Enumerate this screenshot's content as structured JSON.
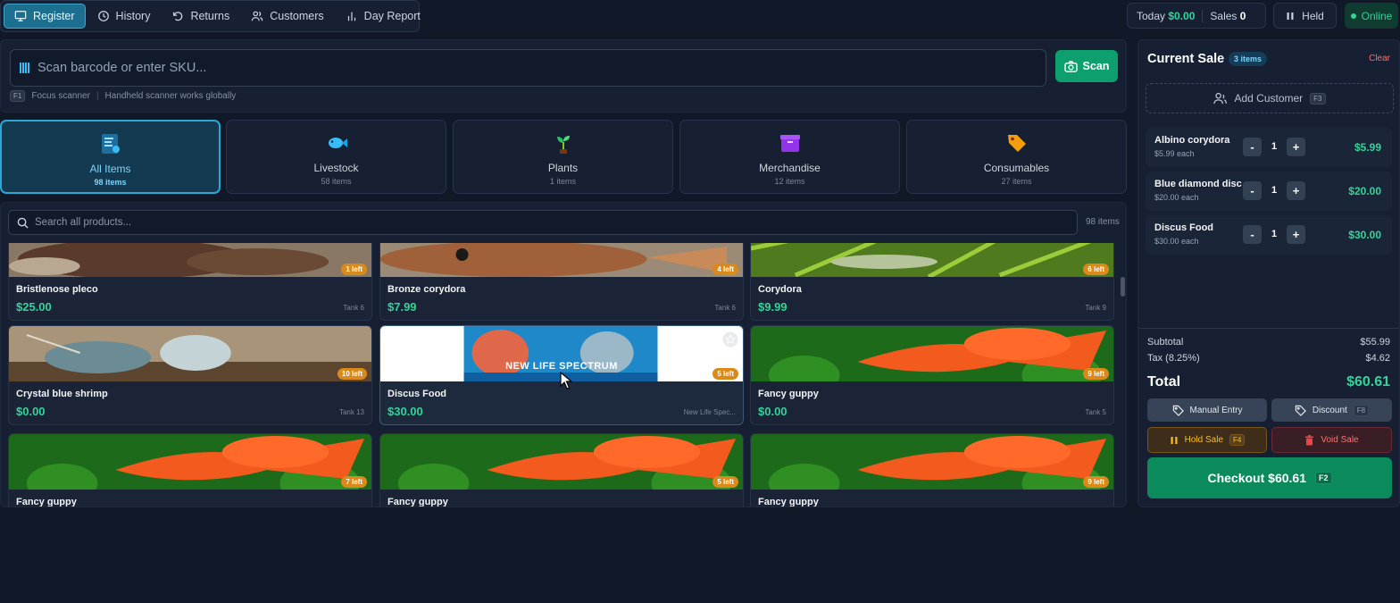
{
  "nav": {
    "items": [
      {
        "label": "Register",
        "icon": "monitor-icon",
        "active": true
      },
      {
        "label": "History",
        "icon": "clock-icon",
        "active": false
      },
      {
        "label": "Returns",
        "icon": "rotate-icon",
        "active": false
      },
      {
        "label": "Customers",
        "icon": "users-icon",
        "active": false
      },
      {
        "label": "Day Report",
        "icon": "bar-chart-icon",
        "active": false
      }
    ]
  },
  "status": {
    "today_label": "Today",
    "today_value": "$0.00",
    "sales_label": "Sales",
    "sales_value": "0",
    "held_label": "Held",
    "online_label": "Online"
  },
  "scanner": {
    "placeholder": "Scan barcode or enter SKU...",
    "scan_label": "Scan",
    "hint_key": "F1",
    "hint_focus": "Focus scanner",
    "hint_global": "Handheld scanner works globally"
  },
  "categories": [
    {
      "name": "All Items",
      "count": "98 items",
      "icon": "list-icon",
      "active": true
    },
    {
      "name": "Livestock",
      "count": "58 items",
      "icon": "fish-icon",
      "active": false
    },
    {
      "name": "Plants",
      "count": "1 items",
      "icon": "sprout-icon",
      "active": false
    },
    {
      "name": "Merchandise",
      "count": "12 items",
      "icon": "box-icon",
      "active": false
    },
    {
      "name": "Consumables",
      "count": "27 items",
      "icon": "tag-icon",
      "active": false
    }
  ],
  "search": {
    "placeholder": "Search all products...",
    "count": "98 items"
  },
  "products": [
    {
      "name": "Bristlenose pleco",
      "price": "$25.00",
      "location": "Tank 6",
      "stock": "1 left"
    },
    {
      "name": "Bronze corydora",
      "price": "$7.99",
      "location": "Tank 6",
      "stock": "4 left"
    },
    {
      "name": "Corydora",
      "price": "$9.99",
      "location": "Tank 9",
      "stock": "6 left"
    },
    {
      "name": "Crystal blue shrimp",
      "price": "$0.00",
      "location": "Tank 13",
      "stock": "10 left"
    },
    {
      "name": "Discus Food",
      "price": "$30.00",
      "location": "New Life Spec...",
      "stock": "5 left",
      "image_text": "NEW LIFE SPECTRUM"
    },
    {
      "name": "Fancy guppy",
      "price": "$0.00",
      "location": "Tank 5",
      "stock": "9 left"
    },
    {
      "name": "Fancy guppy",
      "price": "",
      "location": "",
      "stock": "7 left"
    },
    {
      "name": "Fancy guppy",
      "price": "",
      "location": "",
      "stock": "5 left"
    },
    {
      "name": "Fancy guppy",
      "price": "",
      "location": "",
      "stock": "9 left"
    }
  ],
  "sale": {
    "title": "Current Sale",
    "items_badge": "3 items",
    "clear_label": "Clear",
    "add_customer_label": "Add Customer",
    "add_customer_key": "F3",
    "lines": [
      {
        "name": "Albino corydora",
        "each": "$5.99 each",
        "qty": "1",
        "total": "$5.99"
      },
      {
        "name": "Blue diamond disc",
        "each": "$20.00 each",
        "qty": "1",
        "total": "$20.00"
      },
      {
        "name": "Discus Food",
        "each": "$30.00 each",
        "qty": "1",
        "total": "$30.00"
      }
    ],
    "minus": "-",
    "plus": "+",
    "subtotal_label": "Subtotal",
    "subtotal_value": "$55.99",
    "tax_label": "Tax (8.25%)",
    "tax_value": "$4.62",
    "total_label": "Total",
    "total_value": "$60.61",
    "manual_entry_label": "Manual Entry",
    "discount_label": "Discount",
    "discount_key": "F8",
    "hold_label": "Hold Sale",
    "hold_key": "F4",
    "void_label": "Void Sale",
    "checkout_label": "Checkout $60.61",
    "checkout_key": "F2"
  },
  "colors": {
    "accent": "#1c6f8f",
    "success": "#34d399",
    "stock_badge": "#d98a1b",
    "danger": "#f87171"
  }
}
